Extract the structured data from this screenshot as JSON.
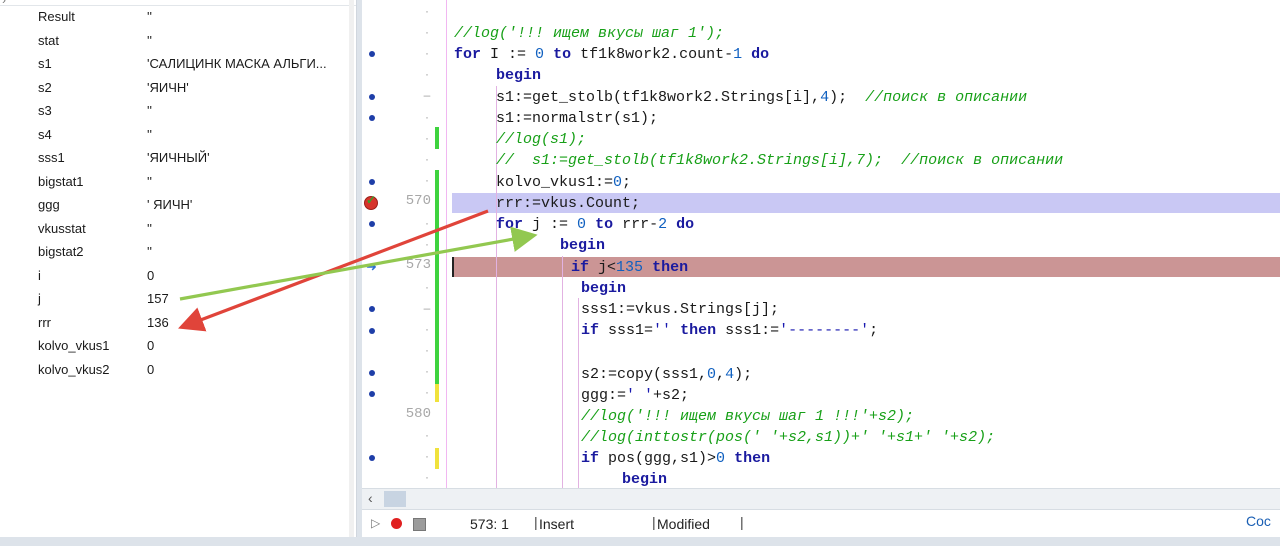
{
  "watches": [
    {
      "name": "Result",
      "value": "''"
    },
    {
      "name": "stat",
      "value": "''"
    },
    {
      "name": "s1",
      "value": "'САЛИЦИНК МАСКА АЛЬГИ..."
    },
    {
      "name": "s2",
      "value": "'ЯИЧН'"
    },
    {
      "name": "s3",
      "value": "''"
    },
    {
      "name": "s4",
      "value": "''"
    },
    {
      "name": "sss1",
      "value": "'ЯИЧНЫЙ'"
    },
    {
      "name": "bigstat1",
      "value": "''"
    },
    {
      "name": "ggg",
      "value": "' ЯИЧН'"
    },
    {
      "name": "vkusstat",
      "value": "''"
    },
    {
      "name": "bigstat2",
      "value": "''"
    },
    {
      "name": "i",
      "value": "0"
    },
    {
      "name": "j",
      "value": "157"
    },
    {
      "name": "rrr",
      "value": "136"
    },
    {
      "name": "kolvo_vkus1",
      "value": "0"
    },
    {
      "name": "kolvo_vkus2",
      "value": "0"
    }
  ],
  "gutter": {
    "line_570": "570",
    "line_573": "573",
    "line_580": "580"
  },
  "status": {
    "position": "573:   1",
    "mode": "Insert",
    "modified": "Modified",
    "right_cut": "Coc"
  },
  "highlight_colors": {
    "current_line": "#c9c8f4",
    "execution_line": "#cb9595",
    "arrow_red": "#e0443a",
    "arrow_green": "#92c850"
  }
}
